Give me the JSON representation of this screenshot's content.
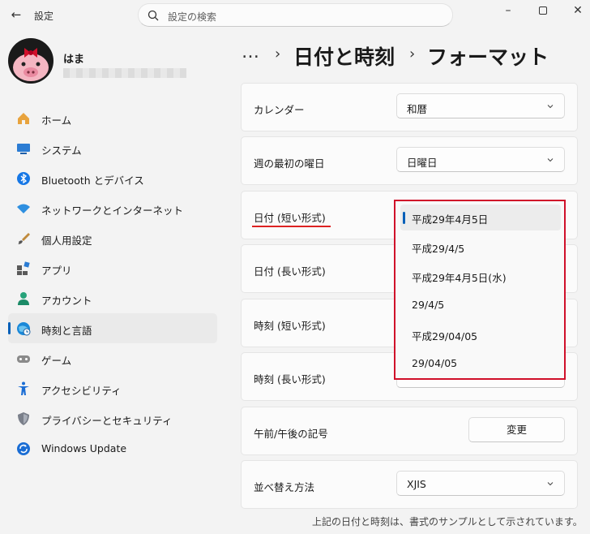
{
  "window": {
    "app_title": "設定",
    "back_icon": "back-arrow-icon",
    "search_placeholder": "設定の検索",
    "controls": [
      "minimize",
      "maximize",
      "close"
    ]
  },
  "user": {
    "name": "はま"
  },
  "nav": [
    {
      "label": "ホーム",
      "icon": "home-icon"
    },
    {
      "label": "システム",
      "icon": "system-icon"
    },
    {
      "label": "Bluetooth とデバイス",
      "icon": "bluetooth-icon"
    },
    {
      "label": "ネットワークとインターネット",
      "icon": "wifi-icon"
    },
    {
      "label": "個人用設定",
      "icon": "brush-icon"
    },
    {
      "label": "アプリ",
      "icon": "apps-icon"
    },
    {
      "label": "アカウント",
      "icon": "account-icon"
    },
    {
      "label": "時刻と言語",
      "icon": "time-language-icon",
      "active": true
    },
    {
      "label": "ゲーム",
      "icon": "gamepad-icon"
    },
    {
      "label": "アクセシビリティ",
      "icon": "accessibility-icon"
    },
    {
      "label": "プライバシーとセキュリティ",
      "icon": "shield-icon"
    },
    {
      "label": "Windows Update",
      "icon": "update-icon"
    }
  ],
  "breadcrumb": {
    "ellipsis": "…",
    "parent": "日付と時刻",
    "current": "フォーマット",
    "separator": "›"
  },
  "settings": {
    "calendar": {
      "label": "カレンダー",
      "value": "和暦"
    },
    "first_day": {
      "label": "週の最初の曜日",
      "value": "日曜日"
    },
    "short_date": {
      "label": "日付 (短い形式)"
    },
    "long_date": {
      "label": "日付 (長い形式)"
    },
    "short_time": {
      "label": "時刻 (短い形式)"
    },
    "long_time": {
      "label": "時刻 (長い形式)"
    },
    "ampm": {
      "label": "午前/午後の記号",
      "button": "変更"
    },
    "sort": {
      "label": "並べ替え方法",
      "value": "XJIS"
    }
  },
  "short_date_options": [
    "平成29年4月5日",
    "平成29/4/5",
    "平成29年4月5日(水)",
    "29/4/5",
    "平成29/04/05",
    "29/04/05"
  ],
  "short_date_selected_index": 0,
  "footnote": "上記の日付と時刻は、書式のサンプルとして示されています。",
  "colors": {
    "accent": "#005fb8",
    "highlight_border": "#d0102a"
  }
}
